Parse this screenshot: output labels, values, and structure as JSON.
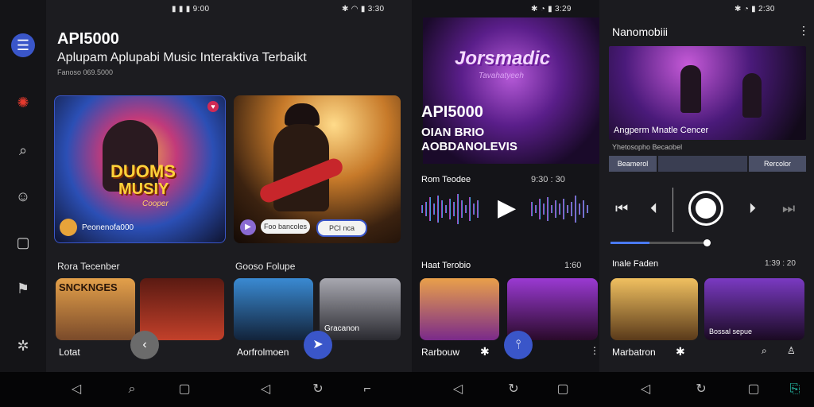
{
  "status": {
    "p1_time": "▮ ▮ ▮ 9:00",
    "p1_right": "✱ ◠ ▮ 3:30",
    "p2_right": "✱ ◔ ▮ 3:29",
    "p3_right": "✱ ◔ ▮ 2:30"
  },
  "panel1": {
    "app_title": "API5000",
    "subtitle": "Aplupam Aplupabi Music Interaktiva Terbaikt",
    "meta": "Fanoso 069.5000",
    "card1": {
      "art_text_1": "DUOMS",
      "art_text_2": "MUSIY",
      "art_text_3": "Cooper",
      "caption": "Peonenofa000"
    },
    "card2": {
      "chip1": "Foo bancoles",
      "chip2": "PCI  nca"
    },
    "section1": "Rora Tecenber",
    "section2": "Gooso Folupe",
    "tile_art_text": "SNCKNGES",
    "tile_caption": "Gracanon",
    "bottom_left": "Lotat",
    "bottom_right": "Aorfrolmoen"
  },
  "panel2": {
    "hero_art_text": "Jorsmadic",
    "hero_art_sub": "Tavahatyeeh",
    "title": "API5000",
    "line1": "OIAN BRIO",
    "line2": "AOBDANOLEVIS",
    "now_label": "Rom Teodee",
    "now_time": "9:30 : 30",
    "section": "Haat Terobio",
    "section_time": "1:60",
    "bottom_label": "Rarbouw"
  },
  "panel3": {
    "title": "Nanomobiii",
    "track_title": "Angperm Mnatle Cencer",
    "track_sub": "Yhetosopho Becaobel",
    "chip_left": "Beamerol",
    "chip_right": "Rercolor",
    "progress": 0.4,
    "section": "Inale Faden",
    "section_time": "1:39 : 20",
    "tile_caption": "Bossal sepue",
    "bottom_label": "Marbatron"
  },
  "colors": {
    "accent_blue": "#3a56c9",
    "accent_red": "#e5392d",
    "teal": "#27c6b0"
  },
  "icons": {
    "rail": [
      "menu-icon",
      "star-icon",
      "search-icon",
      "smile-icon",
      "square-icon",
      "megaphone-icon",
      "settings-icon"
    ]
  }
}
